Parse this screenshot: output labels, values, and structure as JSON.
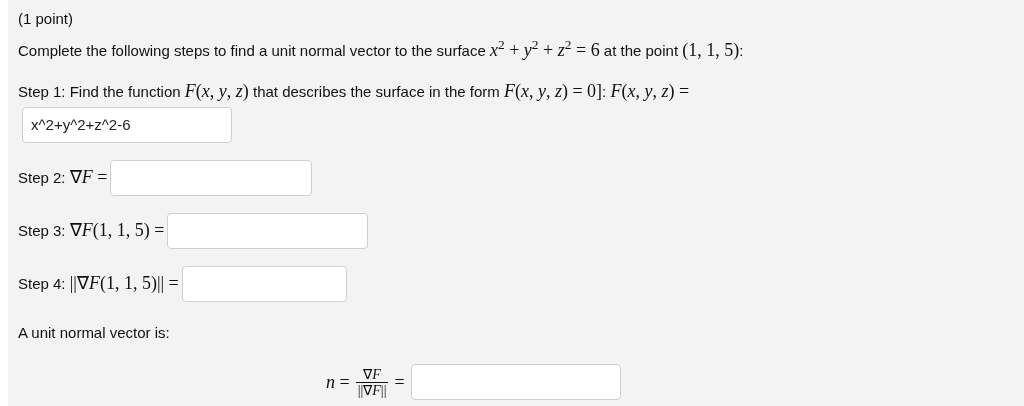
{
  "header": {
    "points": "(1 point)"
  },
  "intro": [
    {
      "kind": "text",
      "text": "Complete the following steps to find a unit normal vector to the surface "
    },
    {
      "kind": "math",
      "text": "*x*$^{2}$ + *y*$^{2}$ + *z*$^{2}$ = 6"
    },
    {
      "kind": "text",
      "text": " at the point "
    },
    {
      "kind": "math",
      "text": "(1, 1, 5)"
    },
    {
      "kind": "text",
      "text": ":"
    }
  ],
  "steps": [
    {
      "kind": "block",
      "label": [
        {
          "kind": "text",
          "text": "Step 1: Find the function "
        },
        {
          "kind": "math",
          "text": "*F*(*x*, *y*, *z*)"
        },
        {
          "kind": "text",
          "text": " that describes the surface in the form "
        },
        {
          "kind": "math",
          "text": "*F*(*x*, *y*, *z*) = 0]"
        },
        {
          "kind": "text",
          "text": ": "
        },
        {
          "kind": "math",
          "text": "*F*(*x*, *y*, *z*) ="
        }
      ],
      "value": "x^2+y^2+z^2-6"
    },
    {
      "kind": "inline",
      "label": [
        {
          "kind": "text",
          "text": "Step 2: "
        },
        {
          "kind": "math",
          "text": "∇*F* ="
        }
      ]
    },
    {
      "kind": "inline",
      "label": [
        {
          "kind": "text",
          "text": "Step 3: "
        },
        {
          "kind": "math",
          "text": "∇*F*(1, 1, 5) ="
        }
      ]
    },
    {
      "kind": "inline",
      "label": [
        {
          "kind": "text",
          "text": "Step 4: "
        },
        {
          "kind": "math",
          "text": "||∇*F*(1, 1, 5)|| ="
        }
      ]
    }
  ],
  "conclusion": "A unit normal vector is:",
  "formula": {
    "lhs": "*n* =",
    "numerator": "∇*F*",
    "denominator": "||∇*F*||",
    "rhs": "="
  }
}
